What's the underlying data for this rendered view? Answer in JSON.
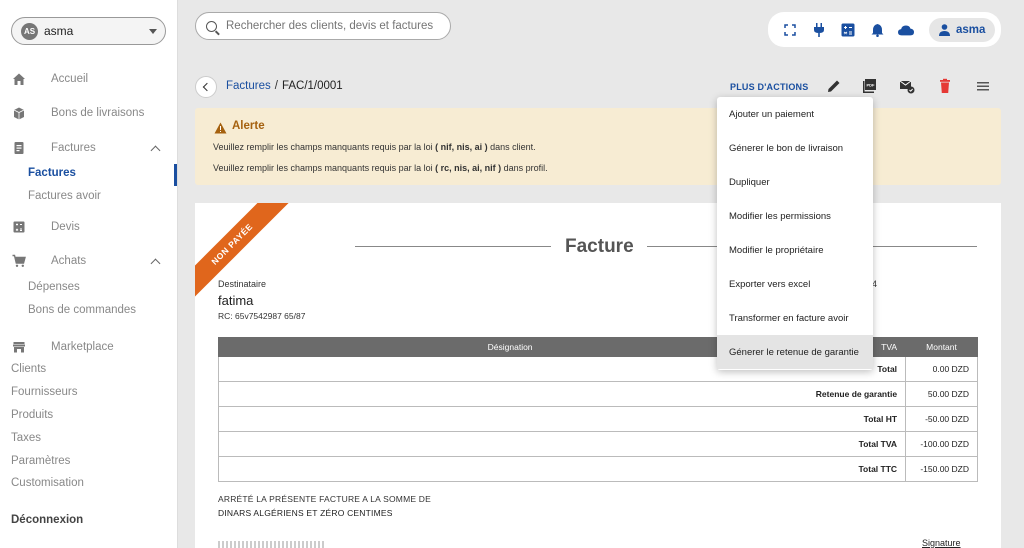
{
  "user": {
    "initials": "AS",
    "name": "asma"
  },
  "sidebar": {
    "items": [
      {
        "label": "Accueil",
        "icon": "home-icon"
      },
      {
        "label": "Bons de livraisons",
        "icon": "box-icon"
      },
      {
        "label": "Factures",
        "icon": "invoice-icon",
        "expanded": true
      },
      {
        "label": "Devis",
        "icon": "calculator-icon"
      },
      {
        "label": "Achats",
        "icon": "cart-icon",
        "expanded": true
      },
      {
        "label": "Marketplace",
        "icon": "store-icon"
      }
    ],
    "factures_sub": [
      "Factures",
      "Factures avoir"
    ],
    "achats_sub": [
      "Dépenses",
      "Bons de commandes"
    ],
    "plain": [
      "Clients",
      "Fournisseurs",
      "Produits",
      "Taxes",
      "Paramètres",
      "Customisation"
    ],
    "logout": "Déconnexion"
  },
  "search": {
    "placeholder": "Rechercher des clients, devis et factures"
  },
  "topbar": {
    "icons": [
      "fullscreen-icon",
      "plug-icon",
      "calculator-icon",
      "bell-icon",
      "cloud-icon"
    ],
    "user_label": "asma"
  },
  "breadcrumb": {
    "parent": "Factures",
    "current": "FAC/1/0001"
  },
  "actions": {
    "more_label": "PLUS D'ACTIONS",
    "icons": [
      "edit-icon",
      "pdf-icon",
      "email-icon",
      "delete-icon",
      "menu-icon"
    ],
    "danger_color": "#e53935"
  },
  "alert": {
    "title": "Alerte",
    "line1_prefix": "Veuillez remplir les champs manquants requis par la loi",
    "line1_fields": "( nif, nis, ai )",
    "line1_suffix": "dans client.",
    "line2_prefix": "Veuillez remplir les champs manquants requis par la loi",
    "line2_fields": "( rc, nis, ai, nif )",
    "line2_suffix": "dans profil."
  },
  "invoice": {
    "status": "NON PAYÉE",
    "title": "Facture",
    "recipient_label": "Destinataire",
    "recipient_name": "fatima",
    "recipient_rc": "RC: 65v7542987 65/87",
    "partial_text": "4",
    "columns": [
      "Désignation",
      "TVA",
      "Montant"
    ],
    "totals": [
      {
        "label": "Total",
        "value": "0.00 DZD"
      },
      {
        "label": "Retenue de garantie",
        "value": "50.00 DZD"
      },
      {
        "label": "Total HT",
        "value": "-50.00 DZD"
      },
      {
        "label": "Total TVA",
        "value": "-100.00 DZD"
      },
      {
        "label": "Total TTC",
        "value": "-150.00 DZD"
      }
    ],
    "arrete_line1": "ARRÉTÉ LA PRÉSENTE FACTURE A LA SOMME DE",
    "arrete_line2": "DINARS ALGÉRIENS ET ZÉRO CENTIMES",
    "signature": "Signature"
  },
  "menu": {
    "items": [
      "Ajouter un paiement",
      "Génerer le bon de livraison",
      "Dupliquer",
      "Modifier les permissions",
      "Modifier le propriétaire",
      "Exporter vers excel",
      "Transformer en facture avoir",
      "Génerer le retenue de garantie"
    ],
    "highlighted_index": 7
  },
  "colors": {
    "primary": "#1a4fa0",
    "ribbon": "#e0661c",
    "alert_bg": "#f7ecd3",
    "alert_title": "#a5610f"
  }
}
